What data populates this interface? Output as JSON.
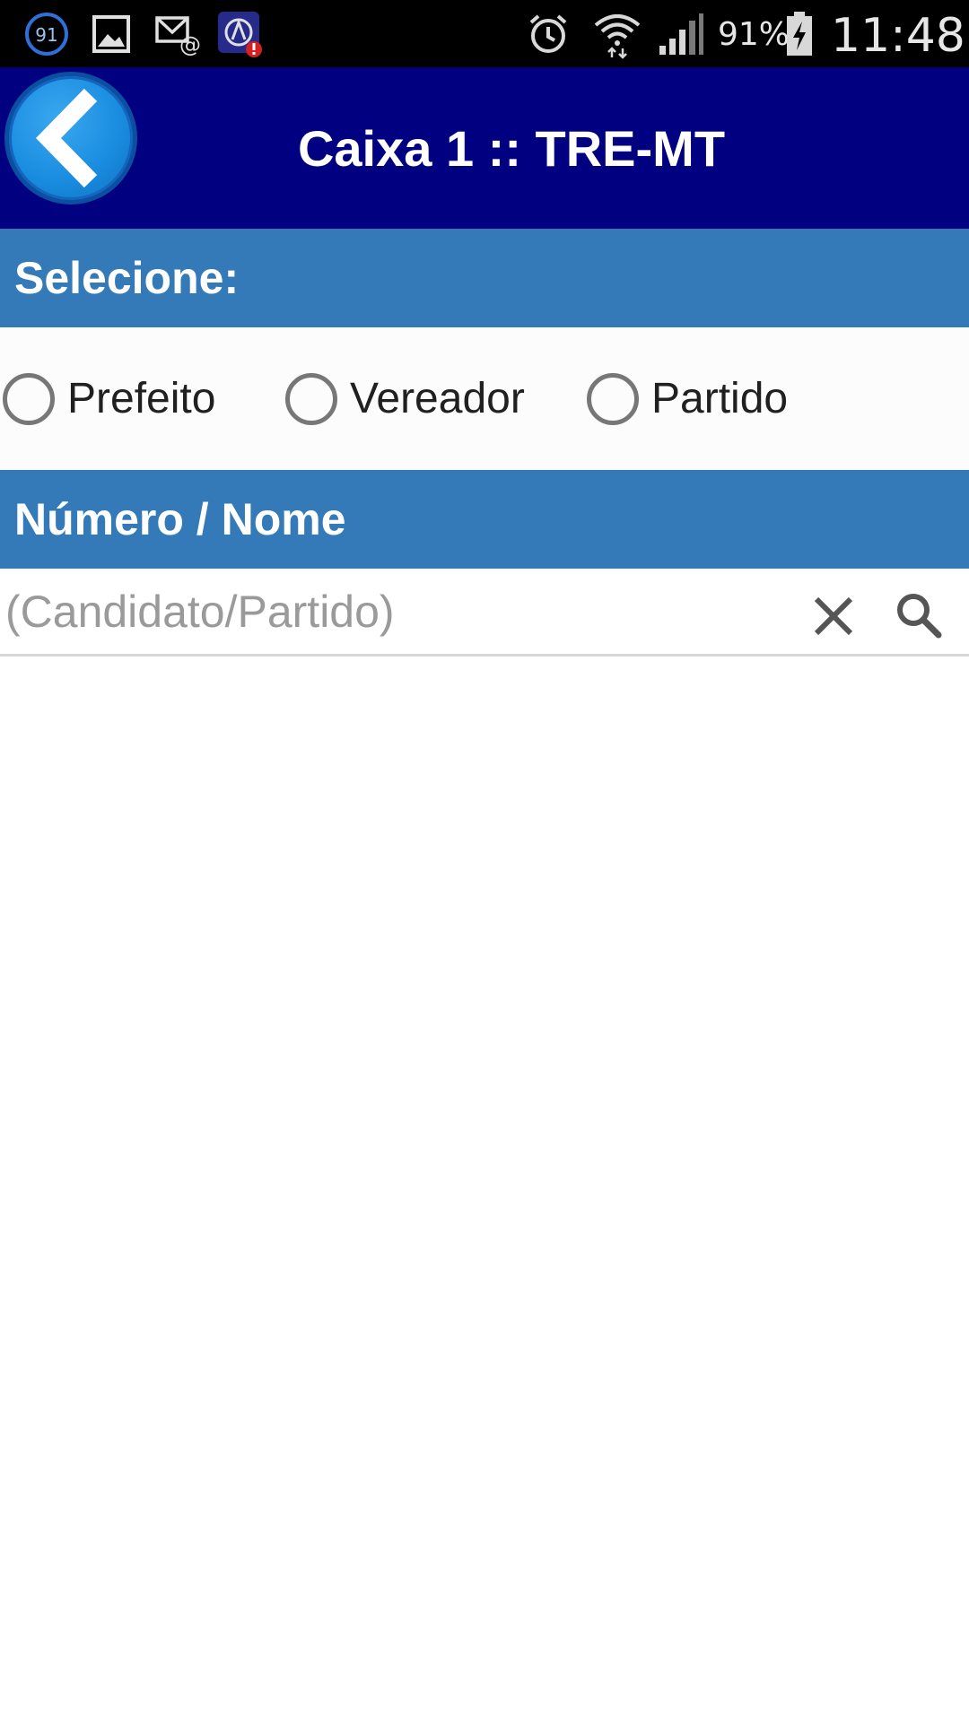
{
  "status_bar": {
    "notification_badge": "91",
    "battery_percent": "91%",
    "time": "11:48",
    "icons": [
      "notification-count-icon",
      "gallery-icon",
      "email-icon",
      "app-alert-icon",
      "alarm-icon",
      "wifi-icon",
      "signal-icon",
      "battery-charging-icon"
    ]
  },
  "header": {
    "title": "Caixa 1 :: TRE-MT",
    "back_icon": "chevron-left-icon",
    "background_color": "#010080",
    "back_button_color": "#1a8de0"
  },
  "select_section": {
    "label": "Selecione:",
    "options": [
      {
        "label": "Prefeito",
        "selected": false
      },
      {
        "label": "Vereador",
        "selected": false
      },
      {
        "label": "Partido",
        "selected": false
      }
    ]
  },
  "search_section": {
    "label": "Número / Nome",
    "placeholder": "(Candidato/Partido)",
    "value": "",
    "clear_icon": "close-icon",
    "search_icon": "search-icon"
  },
  "colors": {
    "section_bar": "#357ab8",
    "radio_border": "#777777"
  }
}
